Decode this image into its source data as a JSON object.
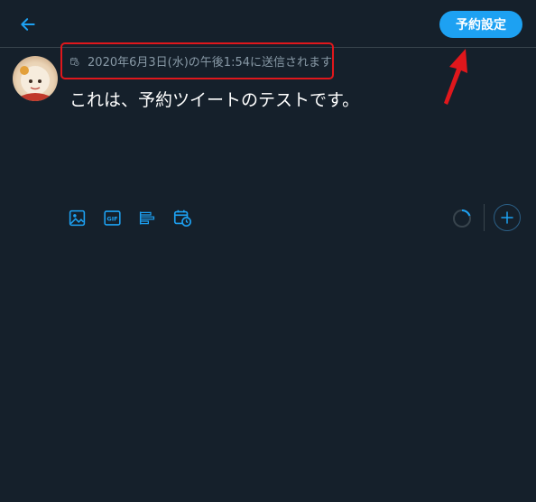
{
  "header": {
    "back_icon": "arrow-left-icon",
    "schedule_button_label": "予約設定"
  },
  "composer": {
    "schedule_icon": "calendar-clock-icon",
    "schedule_text": "2020年6月3日(水)の午後1:54に送信されます",
    "tweet_text": "これは、予約ツイートのテストです。"
  },
  "toolbar": {
    "icons": [
      "image-icon",
      "gif-icon",
      "poll-icon",
      "schedule-icon"
    ],
    "gif_label": "GIF"
  },
  "colors": {
    "background": "#15202b",
    "accent": "#1da1f2",
    "annotation": "#e0171c",
    "muted": "#8899a6"
  }
}
